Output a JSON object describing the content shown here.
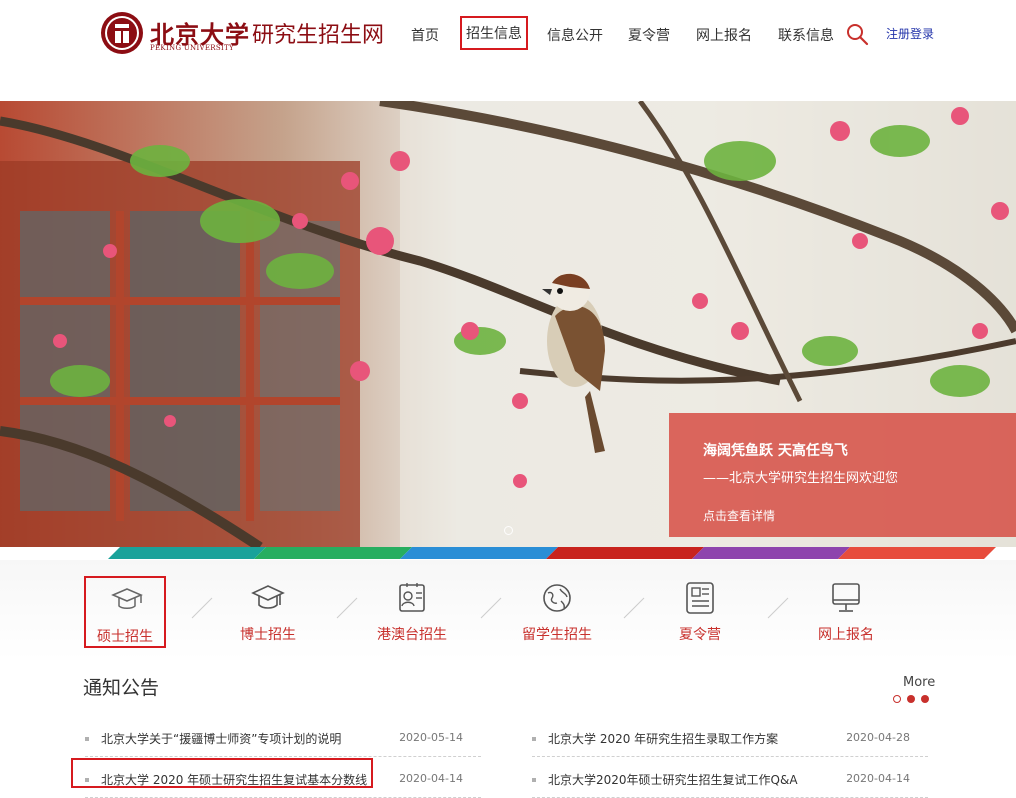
{
  "header": {
    "logo_cn": "北京大学",
    "logo_en": "PEKING UNIVERSITY",
    "site_title": "研究生招生网",
    "nav": [
      "首页",
      "招生信息",
      "信息公开",
      "夏令营",
      "网上报名",
      "联系信息"
    ],
    "active_nav_index": 1,
    "login_label": "注册登录",
    "search_icon": "search-icon"
  },
  "banner": {
    "slogan_main": "海阔凭鱼跃 天高任鸟飞",
    "slogan_sub": "——北京大学研究生招生网欢迎您",
    "detail_link": "点击查看详情",
    "strip_colors": [
      "#1aa29a",
      "#27ae60",
      "#2a8ed6",
      "#c8231d",
      "#8e44ad",
      "#e74c3c"
    ]
  },
  "quick_links": [
    {
      "label": "硕士招生",
      "icon": "graduation-cap-icon"
    },
    {
      "label": "博士招生",
      "icon": "doctoral-cap-icon"
    },
    {
      "label": "港澳台招生",
      "icon": "id-card-icon"
    },
    {
      "label": "留学生招生",
      "icon": "globe-icon"
    },
    {
      "label": "夏令营",
      "icon": "document-icon"
    },
    {
      "label": "网上报名",
      "icon": "computer-monitor-icon"
    }
  ],
  "active_quick_index": 0,
  "notices": {
    "title": "通知公告",
    "more_label": "More",
    "left": [
      {
        "text": "北京大学关于“援疆博士师资”专项计划的说明",
        "date": "2020-05-14"
      },
      {
        "text": "北京大学 2020 年硕士研究生招生复试基本分数线",
        "date": "2020-04-14"
      }
    ],
    "right": [
      {
        "text": "北京大学 2020 年研究生招生录取工作方案",
        "date": "2020-04-28"
      },
      {
        "text": "北京大学2020年硕士研究生招生复试工作Q&A",
        "date": "2020-04-14"
      }
    ],
    "pager_colors": [
      "#ffffff",
      "#c8302c",
      "#c8302c"
    ]
  }
}
